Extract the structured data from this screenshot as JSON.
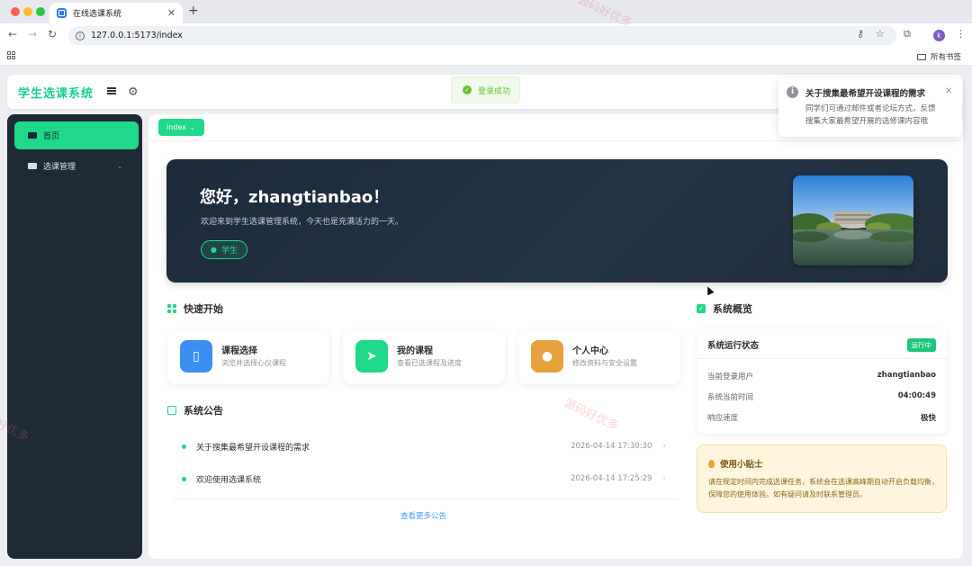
{
  "browser": {
    "tab_title": "在线选课系统",
    "url": "127.0.0.1:5173/index",
    "bookmarks_label": "所有书签",
    "avatar_letter": "k"
  },
  "header": {
    "logo": "学生选课系统",
    "menu_icon": "hamburger-icon",
    "settings_icon": "gear-icon"
  },
  "toast": {
    "text": "登录成功"
  },
  "notification": {
    "title": "关于搜集最希望开设课程的需求",
    "body": "同学们可通过邮件或者论坛方式，反馈搜集大家最希望开展的选修课内容哦"
  },
  "sidebar": {
    "items": [
      {
        "label": "首页",
        "active": true
      },
      {
        "label": "选课管理",
        "active": false
      }
    ]
  },
  "tags": [
    {
      "label": "index"
    }
  ],
  "banner": {
    "greeting": "您好，zhangtianbao！",
    "welcome": "欢迎来到学生选课管理系统，今天也是充满活力的一天。",
    "role": "学生"
  },
  "quick_start": {
    "title": "快速开始",
    "cards": [
      {
        "title": "课程选择",
        "desc": "浏览并选择心仪课程",
        "color": "#3b8ff3"
      },
      {
        "title": "我的课程",
        "desc": "查看已选课程及进度",
        "color": "#1fd889"
      },
      {
        "title": "个人中心",
        "desc": "修改资料与安全设置",
        "color": "#e6a23c"
      }
    ]
  },
  "announcements": {
    "title": "系统公告",
    "items": [
      {
        "text": "关于搜集最希望开设课程的需求",
        "date": "2026-04-14 17:30:30"
      },
      {
        "text": "欢迎使用选课系统",
        "date": "2026-04-14 17:25:29"
      }
    ],
    "more": "查看更多公告"
  },
  "overview": {
    "title": "系统概览",
    "status_title": "系统运行状态",
    "status_badge": "运行中",
    "rows": [
      {
        "key": "当前登录用户",
        "value": "zhangtianbao"
      },
      {
        "key": "系统当前时间",
        "value": "04:00:49"
      },
      {
        "key": "响应速度",
        "value": "极快"
      }
    ]
  },
  "tips": {
    "title": "使用小贴士",
    "body": "请在规定时间内完成选课任务，系统会在选课高峰期自动开启负载均衡，保障您的使用体验。如有疑问请及时联系管理员。"
  },
  "watermark": "源码好优多",
  "colors": {
    "accent": "#1fd889",
    "sidebar": "#1e2a36",
    "banner": "#1f2d3d"
  }
}
